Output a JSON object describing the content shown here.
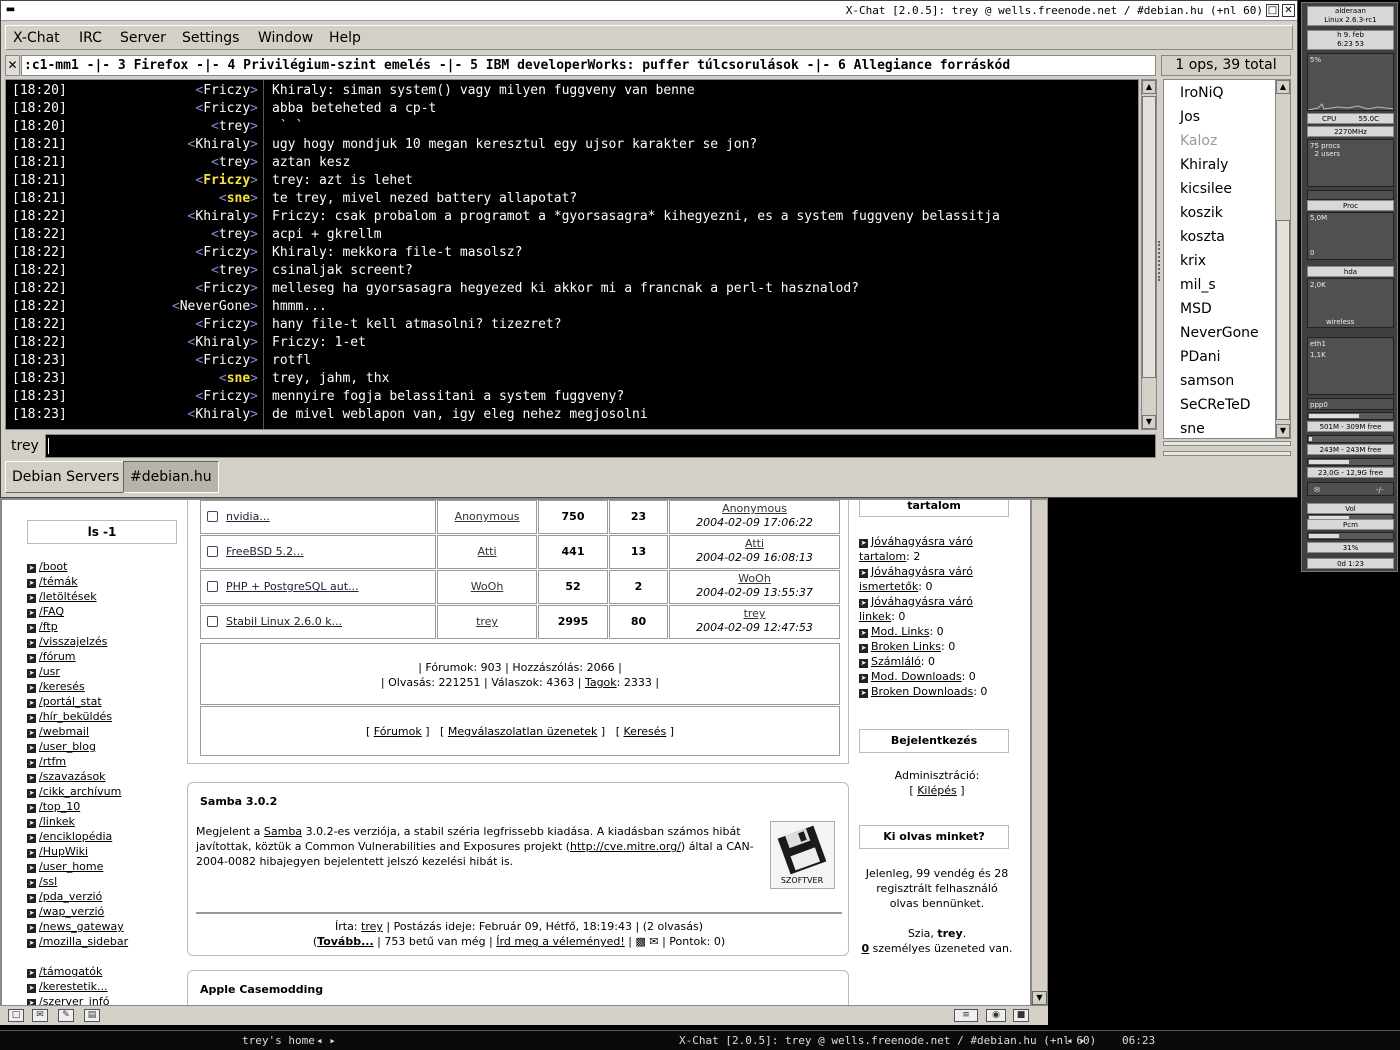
{
  "xchat": {
    "title": "X-Chat [2.0.5]: trey @ wells.freenode.net / #debian.hu (+nl 60)",
    "menu": [
      "X-Chat",
      "IRC",
      "Server",
      "Settings",
      "Window",
      "Help"
    ],
    "topic": ":c1-mm1 -|- 3 Firefox -|- 4 Privilégium-szint emelés -|- 5 IBM developerWorks: puffer túlcsorulások -|- 6 Allegiance forráskód",
    "ops_total": "1 ops, 39 total",
    "nick": "trey",
    "input_value": "",
    "tabs": [
      "Debian Servers",
      "#debian.hu"
    ],
    "messages": [
      {
        "time": "[18:20]",
        "nick": "Friczy",
        "text": "Khiraly: siman system() vagy milyen fuggveny van benne",
        "highlight": false
      },
      {
        "time": "[18:20]",
        "nick": "Friczy",
        "text": "abba beteheted a cp-t",
        "highlight": false
      },
      {
        "time": "[18:20]",
        "nick": "trey",
        "text": " ` `",
        "highlight": false
      },
      {
        "time": "[18:21]",
        "nick": "Khiraly",
        "text": "ugy hogy mondjuk 10 megan keresztul egy ujsor karakter se jon?",
        "highlight": false
      },
      {
        "time": "[18:21]",
        "nick": "trey",
        "text": "aztan kesz",
        "highlight": false
      },
      {
        "time": "[18:21]",
        "nick": "Friczy",
        "text": "trey: azt is lehet",
        "highlight": true
      },
      {
        "time": "[18:21]",
        "nick": "sne",
        "text": "te trey, mivel nezed battery allapotat?",
        "highlight": true
      },
      {
        "time": "[18:22]",
        "nick": "Khiraly",
        "text": "Friczy: csak probalom a programot a *gyorsasagra* kihegyezni, es a system fuggveny belassitja",
        "highlight": false
      },
      {
        "time": "[18:22]",
        "nick": "trey",
        "text": "acpi + gkrellm",
        "highlight": false
      },
      {
        "time": "[18:22]",
        "nick": "Friczy",
        "text": "Khiraly: mekkora file-t masolsz?",
        "highlight": false
      },
      {
        "time": "[18:22]",
        "nick": "trey",
        "text": "csinaljak screent?",
        "highlight": false
      },
      {
        "time": "[18:22]",
        "nick": "Friczy",
        "text": "melleseg ha gyorsasagra hegyezed ki akkor mi a francnak a perl-t hasznalod?",
        "highlight": false
      },
      {
        "time": "[18:22]",
        "nick": "NeverGone",
        "text": "hmmm...",
        "highlight": false
      },
      {
        "time": "[18:22]",
        "nick": "Friczy",
        "text": "hany file-t kell atmasolni? tizezret?",
        "highlight": false
      },
      {
        "time": "[18:22]",
        "nick": "Khiraly",
        "text": "Friczy: 1-et",
        "highlight": false
      },
      {
        "time": "[18:23]",
        "nick": "Friczy",
        "text": "rotfl",
        "highlight": false
      },
      {
        "time": "[18:23]",
        "nick": "sne",
        "text": "trey, jahm, thx",
        "highlight": true
      },
      {
        "time": "[18:23]",
        "nick": "Friczy",
        "text": "mennyire fogja belassitani a system fuggveny?",
        "highlight": false
      },
      {
        "time": "[18:23]",
        "nick": "Khiraly",
        "text": "de mivel weblapon van, igy eleg nehez megjosolni",
        "highlight": false
      }
    ],
    "users": [
      {
        "name": "IroNiQ",
        "away": false
      },
      {
        "name": "Jos",
        "away": false
      },
      {
        "name": "Kaloz",
        "away": true
      },
      {
        "name": "Khiraly",
        "away": false
      },
      {
        "name": "kicsilee",
        "away": false
      },
      {
        "name": "koszik",
        "away": false
      },
      {
        "name": "koszta",
        "away": false
      },
      {
        "name": "krix",
        "away": false
      },
      {
        "name": "mil_s",
        "away": false
      },
      {
        "name": "MSD",
        "away": false
      },
      {
        "name": "NeverGone",
        "away": false
      },
      {
        "name": "PDani",
        "away": false
      },
      {
        "name": "samson",
        "away": false
      },
      {
        "name": "SeCReTeD",
        "away": false
      },
      {
        "name": "sne",
        "away": false
      }
    ]
  },
  "browser": {
    "nav_title": "ls -1",
    "nav_items": [
      "/boot",
      "/témák",
      "/letöltések",
      "/FAQ",
      "/ftp",
      "/visszajelzés",
      "/fórum",
      "/usr",
      "/keresés",
      "/portál_stat",
      "/hír_beküldés",
      "/webmail",
      "/user_blog",
      "/rtfm",
      "/szavazások",
      "/cikk_archívum",
      "/top_10",
      "/linkek",
      "/enciklopédia",
      "/HupWiki",
      "/user_home",
      "/ssl",
      "/pda_verzió",
      "/wap_verzió",
      "/news_gateway",
      "/mozilla_sidebar"
    ],
    "nav_items2": [
      "/támogatók",
      "/kerestetik...",
      "/szerver_infó"
    ],
    "forum_rows": [
      {
        "topic": "nvidia...",
        "author": "Anonymous",
        "views": "750",
        "replies": "23",
        "last_by": "Anonymous",
        "last_date": "2004-02-09 17:06:22"
      },
      {
        "topic": "FreeBSD 5.2...",
        "author": "Atti",
        "views": "441",
        "replies": "13",
        "last_by": "Atti",
        "last_date": "2004-02-09 16:08:13"
      },
      {
        "topic": "PHP + PostgreSQL aut...",
        "author": "WoOh",
        "views": "52",
        "replies": "2",
        "last_by": "WoOh",
        "last_date": "2004-02-09 13:55:37"
      },
      {
        "topic": "Stabil Linux 2.6.0 k...",
        "author": "trey",
        "views": "2995",
        "replies": "80",
        "last_by": "trey",
        "last_date": "2004-02-09 12:47:53"
      }
    ],
    "stats": {
      "forums_label": "Fórumok:",
      "forums": "903",
      "posts_label": "Hozzászólás:",
      "posts": "2066",
      "reads_label": "Olvasás:",
      "reads": "221251",
      "answers_label": "Válaszok:",
      "answers": "4363",
      "members_label": "Tagok",
      "members": "2333"
    },
    "forum_links": [
      "Fórumok",
      "Megválaszolatlan üzenetek",
      "Keresés"
    ],
    "news1": {
      "title": "Samba 3.0.2",
      "body_pre": "Megjelent a ",
      "body_link": "Samba",
      "body_post": " 3.0.2-es verziója, a stabil széria legfrissebb kiadása. A kiadásban számos hibát javítottak, köztük a Common Vulnerabilities and Exposures projekt (",
      "body_link2": "http://cve.mitre.org/",
      "body_end": ") által a CAN-2004-0082 hibajegyen bejelentett jelszó kezelési hibát is.",
      "logo_label": "SZOFTVER",
      "by_label": "Írta:",
      "by": "trey",
      "posted": "| Postázás ideje: Február 09, Hétfő, 18:19:43 | (2 olvasás)",
      "more": "Tovább...",
      "chars": "| 753 betű van még |",
      "comment": "Írd meg a véleményed!",
      "points": "| Pontok: 0)"
    },
    "news2": {
      "title": "Apple Casemodding"
    },
    "right_title1": "tartalom",
    "right_items": [
      {
        "link": "Jóváhagyásra váró tartalom",
        "value": ": 2"
      },
      {
        "link": "Jóváhagyásra váró ismertetők",
        "value": ": 0"
      },
      {
        "link": "Jóváhagyásra váró linkek",
        "value": ": 0"
      },
      {
        "link": "Mod. Links",
        "value": ": 0"
      },
      {
        "link": "Broken Links",
        "value": ": 0"
      },
      {
        "link": "Számláló",
        "value": ": 0"
      },
      {
        "link": "Mod. Downloads",
        "value": ": 0"
      },
      {
        "link": "Broken Downloads",
        "value": ": 0"
      }
    ],
    "login_title": "Bejelentkezés",
    "admin_label": "Adminisztráció:",
    "logout": "Kilépés",
    "readers_title": "Ki olvas minket?",
    "readers_text": "Jelenleg, 99 vendég és 28 regisztrált felhasználó olvas bennünket.",
    "hello": "Szia, ",
    "hello_user": "trey",
    "messages_count": "0",
    "messages_text": " személyes üzeneted van."
  },
  "gkrellm": {
    "host": "alderaan",
    "kernel": "Linux 2.6.3-rc1",
    "date": "h   9. feb",
    "time": "6:23  53",
    "cpu_pct": "5%",
    "cpu_label": "CPU",
    "cpu_temp": "55.0C",
    "cpu_freq": "2270MHz",
    "procs": "75 procs",
    "users": "2 users",
    "proc_label": "Proc",
    "proc_val": "5,0M",
    "proc_zero": "0",
    "hda_label": "hda",
    "hda_val": "2,0K",
    "wireless_label": "wireless",
    "eth1_label": "eth1",
    "eth1_val": "1,1K",
    "ppp0_label": "ppp0",
    "mem": "501M - 309M free",
    "swap": "243M - 243M free",
    "disk": "23,0G - 12,9G free",
    "mail": "-/-",
    "vol_label": "Vol",
    "pcm_label": "Pcm",
    "battery": "31%",
    "uptime": "0d  1:23"
  },
  "taskbar": {
    "left": "trey's home",
    "window": "X-Chat [2.0.5]: trey @ wells.freenode.net / #debian.hu (+nl 60)",
    "clock": "06:23"
  },
  "colors": {
    "chat_bg": "#000000",
    "highlight_nick": "#f5e23c",
    "nick_bracket": "#8a8ad6"
  }
}
